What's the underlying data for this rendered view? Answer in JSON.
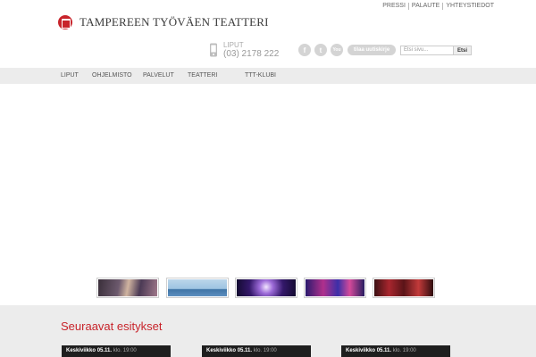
{
  "top_links": [
    "PRESSI",
    "PALAUTE",
    "YHTEYSTIEDOT"
  ],
  "logo": {
    "text": "TAMPEREEN TYÖVÄEN TEATTERI"
  },
  "tickets": {
    "label": "LIPUT",
    "phone": "(03) 2178 222"
  },
  "social": {
    "facebook": "f",
    "twitter": "t",
    "youtube": "You"
  },
  "newsletter_label": "tilaa uutiskirje",
  "search": {
    "placeholder": "Etsi sivu...",
    "button": "Etsi"
  },
  "nav": [
    "LIPUT",
    "OHJELMISTO",
    "PALVELUT",
    "TEATTERI",
    "TTT-KLUBI"
  ],
  "upcoming": {
    "title": "Seuraavat esitykset",
    "events": [
      {
        "day": "Keskiviikko",
        "date": "05.11.",
        "klo": "klo.",
        "time": "19:00"
      },
      {
        "day": "Keskiviikko",
        "date": "05.11.",
        "klo": "klo.",
        "time": "19:00"
      },
      {
        "day": "Keskiviikko",
        "date": "05.11.",
        "klo": "klo.",
        "time": "19:00"
      }
    ]
  },
  "colors": {
    "accent": "#c8242b",
    "nav_bg": "#ececec",
    "card_bg": "#1e1e1e"
  }
}
